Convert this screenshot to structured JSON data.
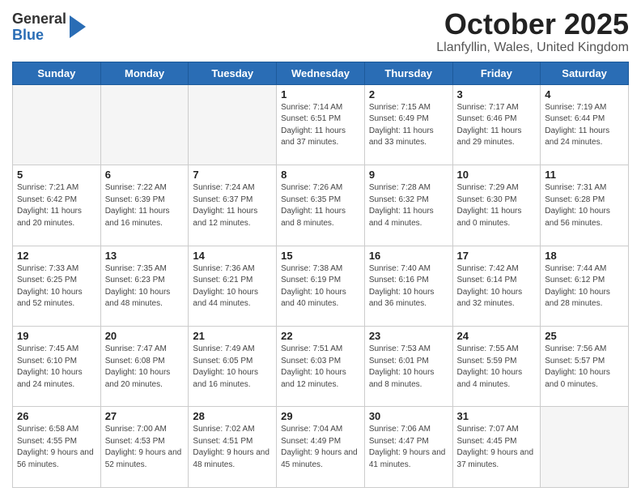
{
  "logo": {
    "general": "General",
    "blue": "Blue"
  },
  "title": "October 2025",
  "location": "Llanfyllin, Wales, United Kingdom",
  "days_of_week": [
    "Sunday",
    "Monday",
    "Tuesday",
    "Wednesday",
    "Thursday",
    "Friday",
    "Saturday"
  ],
  "weeks": [
    [
      {
        "day": "",
        "info": ""
      },
      {
        "day": "",
        "info": ""
      },
      {
        "day": "",
        "info": ""
      },
      {
        "day": "1",
        "info": "Sunrise: 7:14 AM\nSunset: 6:51 PM\nDaylight: 11 hours and 37 minutes."
      },
      {
        "day": "2",
        "info": "Sunrise: 7:15 AM\nSunset: 6:49 PM\nDaylight: 11 hours and 33 minutes."
      },
      {
        "day": "3",
        "info": "Sunrise: 7:17 AM\nSunset: 6:46 PM\nDaylight: 11 hours and 29 minutes."
      },
      {
        "day": "4",
        "info": "Sunrise: 7:19 AM\nSunset: 6:44 PM\nDaylight: 11 hours and 24 minutes."
      }
    ],
    [
      {
        "day": "5",
        "info": "Sunrise: 7:21 AM\nSunset: 6:42 PM\nDaylight: 11 hours and 20 minutes."
      },
      {
        "day": "6",
        "info": "Sunrise: 7:22 AM\nSunset: 6:39 PM\nDaylight: 11 hours and 16 minutes."
      },
      {
        "day": "7",
        "info": "Sunrise: 7:24 AM\nSunset: 6:37 PM\nDaylight: 11 hours and 12 minutes."
      },
      {
        "day": "8",
        "info": "Sunrise: 7:26 AM\nSunset: 6:35 PM\nDaylight: 11 hours and 8 minutes."
      },
      {
        "day": "9",
        "info": "Sunrise: 7:28 AM\nSunset: 6:32 PM\nDaylight: 11 hours and 4 minutes."
      },
      {
        "day": "10",
        "info": "Sunrise: 7:29 AM\nSunset: 6:30 PM\nDaylight: 11 hours and 0 minutes."
      },
      {
        "day": "11",
        "info": "Sunrise: 7:31 AM\nSunset: 6:28 PM\nDaylight: 10 hours and 56 minutes."
      }
    ],
    [
      {
        "day": "12",
        "info": "Sunrise: 7:33 AM\nSunset: 6:25 PM\nDaylight: 10 hours and 52 minutes."
      },
      {
        "day": "13",
        "info": "Sunrise: 7:35 AM\nSunset: 6:23 PM\nDaylight: 10 hours and 48 minutes."
      },
      {
        "day": "14",
        "info": "Sunrise: 7:36 AM\nSunset: 6:21 PM\nDaylight: 10 hours and 44 minutes."
      },
      {
        "day": "15",
        "info": "Sunrise: 7:38 AM\nSunset: 6:19 PM\nDaylight: 10 hours and 40 minutes."
      },
      {
        "day": "16",
        "info": "Sunrise: 7:40 AM\nSunset: 6:16 PM\nDaylight: 10 hours and 36 minutes."
      },
      {
        "day": "17",
        "info": "Sunrise: 7:42 AM\nSunset: 6:14 PM\nDaylight: 10 hours and 32 minutes."
      },
      {
        "day": "18",
        "info": "Sunrise: 7:44 AM\nSunset: 6:12 PM\nDaylight: 10 hours and 28 minutes."
      }
    ],
    [
      {
        "day": "19",
        "info": "Sunrise: 7:45 AM\nSunset: 6:10 PM\nDaylight: 10 hours and 24 minutes."
      },
      {
        "day": "20",
        "info": "Sunrise: 7:47 AM\nSunset: 6:08 PM\nDaylight: 10 hours and 20 minutes."
      },
      {
        "day": "21",
        "info": "Sunrise: 7:49 AM\nSunset: 6:05 PM\nDaylight: 10 hours and 16 minutes."
      },
      {
        "day": "22",
        "info": "Sunrise: 7:51 AM\nSunset: 6:03 PM\nDaylight: 10 hours and 12 minutes."
      },
      {
        "day": "23",
        "info": "Sunrise: 7:53 AM\nSunset: 6:01 PM\nDaylight: 10 hours and 8 minutes."
      },
      {
        "day": "24",
        "info": "Sunrise: 7:55 AM\nSunset: 5:59 PM\nDaylight: 10 hours and 4 minutes."
      },
      {
        "day": "25",
        "info": "Sunrise: 7:56 AM\nSunset: 5:57 PM\nDaylight: 10 hours and 0 minutes."
      }
    ],
    [
      {
        "day": "26",
        "info": "Sunrise: 6:58 AM\nSunset: 4:55 PM\nDaylight: 9 hours and 56 minutes."
      },
      {
        "day": "27",
        "info": "Sunrise: 7:00 AM\nSunset: 4:53 PM\nDaylight: 9 hours and 52 minutes."
      },
      {
        "day": "28",
        "info": "Sunrise: 7:02 AM\nSunset: 4:51 PM\nDaylight: 9 hours and 48 minutes."
      },
      {
        "day": "29",
        "info": "Sunrise: 7:04 AM\nSunset: 4:49 PM\nDaylight: 9 hours and 45 minutes."
      },
      {
        "day": "30",
        "info": "Sunrise: 7:06 AM\nSunset: 4:47 PM\nDaylight: 9 hours and 41 minutes."
      },
      {
        "day": "31",
        "info": "Sunrise: 7:07 AM\nSunset: 4:45 PM\nDaylight: 9 hours and 37 minutes."
      },
      {
        "day": "",
        "info": ""
      }
    ]
  ]
}
